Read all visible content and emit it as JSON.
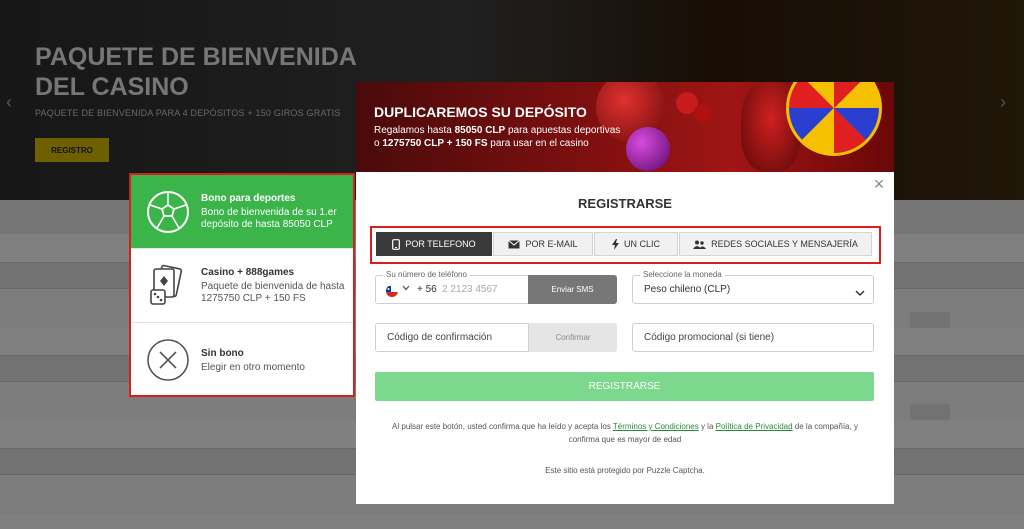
{
  "background": {
    "hero_title": "PAQUETE DE BIENVENIDA DEL CASINO",
    "hero_subtitle": "PAQUETE DE BIENVENIDA PARA 4 DEPÓSITOS + 150 GIROS GRATIS",
    "hero_button": "REGISTRO"
  },
  "bonus_options": [
    {
      "title": "Bono para deportes",
      "desc": "Bono de bienvenida de su 1.er depósito de hasta 85050 CLP",
      "icon": "soccer-ball-icon",
      "selected": true
    },
    {
      "title": "Casino + 888games",
      "desc": "Paquete de bienvenida de hasta 1275750 CLP + 150 FS",
      "icon": "cards-dice-icon",
      "selected": false
    },
    {
      "title": "Sin bono",
      "desc": "Elegir en otro momento",
      "icon": "close-circle-icon",
      "selected": false
    }
  ],
  "banner": {
    "title": "DUPLICAREMOS SU DEPÓSITO",
    "line1_pre": "Regalamos hasta ",
    "line1_bold": "85050 CLP",
    "line1_post": " para apuestas deportivas",
    "line2_pre": "o ",
    "line2_bold": "1275750 CLP + 150 FS",
    "line2_post": " para usar en el casino"
  },
  "modal": {
    "title": "REGISTRARSE",
    "close_icon": "close-icon",
    "tabs": [
      {
        "label": "POR TELEFONO",
        "icon": "phone-icon",
        "active": true
      },
      {
        "label": "POR E-MAIL",
        "icon": "envelope-icon",
        "active": false
      },
      {
        "label": "UN CLIC",
        "icon": "lightning-icon",
        "active": false
      },
      {
        "label": "REDES SOCIALES Y MENSAJERÍA",
        "icon": "people-icon",
        "active": false
      }
    ],
    "phone": {
      "label": "Su número de teléfono",
      "prefix": "+ 56",
      "placeholder": "2 2123 4567",
      "sms_button": "Enviar SMS"
    },
    "currency": {
      "label": "Seleccione la moneda",
      "value": "Peso chileno (CLP)"
    },
    "confirmation": {
      "placeholder": "Código de confirmación",
      "button": "Confirmar"
    },
    "promo": {
      "placeholder": "Código promocional (si tiene)"
    },
    "register_button": "REGISTRARSE",
    "legal": {
      "pre": "Al pulsar este botón, usted confirma que ha leído y acepta los ",
      "terms": "Términos y Condiciones",
      "mid": " y la ",
      "privacy": "Política de Privacidad",
      "post": " de la compañía, y confirma que es mayor de edad"
    },
    "captcha": "Este sitio está protegido por Puzzle Captcha."
  },
  "colors": {
    "accent_green": "#3bb54a",
    "register_green": "#7bd88c",
    "highlight_red": "#d71f1f",
    "tab_active": "#3a3a3a"
  }
}
